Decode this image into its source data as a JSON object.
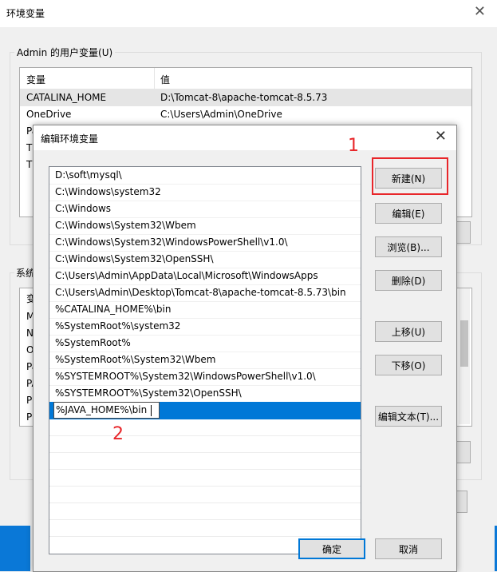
{
  "background_window": {
    "title": "环境变量",
    "close_glyph": "✕",
    "user_group_title": "Admin 的用户变量(U)",
    "user_list": {
      "col_var": "变量",
      "col_val": "值",
      "rows": [
        {
          "name": "CATALINA_HOME",
          "value": "D:\\Tomcat-8\\apache-tomcat-8.5.73"
        },
        {
          "name": "OneDrive",
          "value": "C:\\Users\\Admin\\OneDrive"
        },
        {
          "name": "Pa",
          "value": ""
        },
        {
          "name": "TE",
          "value": ""
        },
        {
          "name": "TM",
          "value": ""
        }
      ]
    },
    "system_group_title": "系统",
    "system_list": {
      "header": "变",
      "rows": [
        "M",
        "N",
        "O",
        "Pa",
        "PA",
        "PF",
        "PF"
      ]
    }
  },
  "dialog": {
    "title": "编辑环境变量",
    "close_glyph": "✕",
    "paths": [
      "D:\\soft\\mysql\\",
      "C:\\Windows\\system32",
      "C:\\Windows",
      "C:\\Windows\\System32\\Wbem",
      "C:\\Windows\\System32\\WindowsPowerShell\\v1.0\\",
      "C:\\Windows\\System32\\OpenSSH\\",
      "C:\\Users\\Admin\\AppData\\Local\\Microsoft\\WindowsApps",
      "C:\\Users\\Admin\\Desktop\\Tomcat-8\\apache-tomcat-8.5.73\\bin",
      "%CATALINA_HOME%\\bin",
      "%SystemRoot%\\system32",
      "%SystemRoot%",
      "%SystemRoot%\\System32\\Wbem",
      "%SYSTEMROOT%\\System32\\WindowsPowerShell\\v1.0\\",
      "%SYSTEMROOT%\\System32\\OpenSSH\\"
    ],
    "editing_value": "%JAVA_HOME%\\bin",
    "buttons": {
      "new": "新建(N)",
      "edit": "编辑(E)",
      "browse": "浏览(B)...",
      "delete": "删除(D)",
      "move_up": "上移(U)",
      "move_down": "下移(O)",
      "edit_text": "编辑文本(T)...",
      "ok": "确定",
      "cancel": "取消"
    }
  },
  "annotations": {
    "step1": "1",
    "step2": "2",
    "color": "#e8262a"
  }
}
